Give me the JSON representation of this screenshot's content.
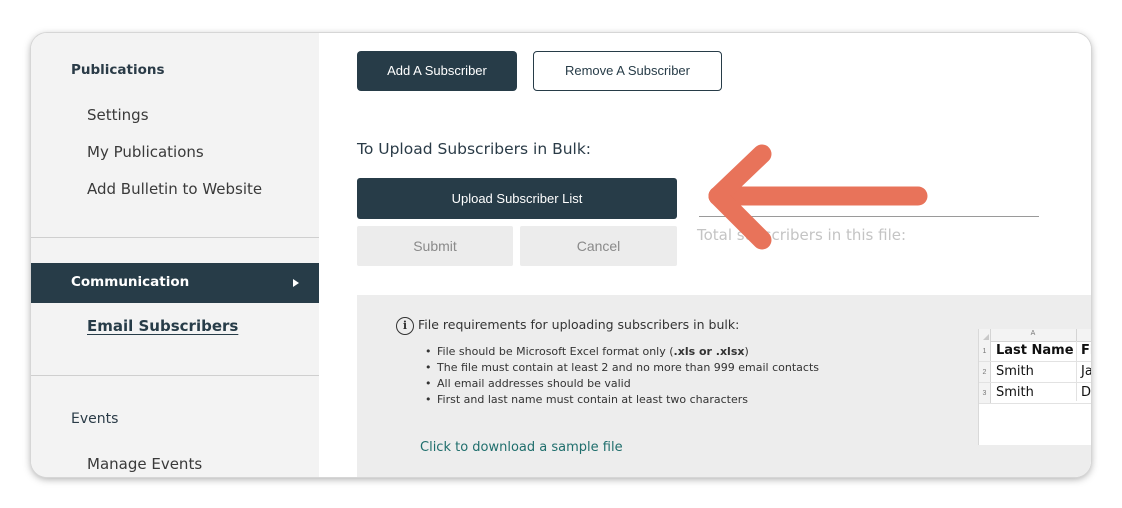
{
  "sidebar": {
    "publications_heading": "Publications",
    "publications_items": [
      "Settings",
      "My Publications",
      "Add Bulletin to Website"
    ],
    "communication_label": "Communication",
    "communication_selected_item": "Email Subscribers",
    "events_heading": "Events",
    "events_items": [
      "Manage Events"
    ]
  },
  "toolbar": {
    "add_subscriber_label": "Add A Subscriber",
    "remove_subscriber_label": "Remove A Subscriber"
  },
  "bulk_upload": {
    "heading": "To Upload Subscribers in Bulk:",
    "upload_button_label": "Upload Subscriber List",
    "submit_label": "Submit",
    "cancel_label": "Cancel",
    "total_label": "Total subscribers in this file:"
  },
  "requirements": {
    "title": "File requirements for uploading subscribers in bulk:",
    "items": [
      {
        "prefix": "File should be Microsoft Excel format only (",
        "bold": ".xls or .xlsx",
        "suffix": ")"
      },
      {
        "prefix": "The file must contain at least 2 and no more than 999 email contacts",
        "bold": "",
        "suffix": ""
      },
      {
        "prefix": "All email addresses should be valid",
        "bold": "",
        "suffix": ""
      },
      {
        "prefix": "First and last name must contain at least two characters",
        "bold": "",
        "suffix": ""
      }
    ],
    "download_link": "Click to download a sample file"
  },
  "sample_sheet": {
    "column_letter": "A",
    "row_numbers": [
      "1",
      "2",
      "3"
    ],
    "col1": [
      "Last Name",
      "Smith",
      "Smith"
    ],
    "col2": [
      "Fi",
      "Ja",
      "D"
    ]
  },
  "colors": {
    "brand_dark": "#273c48",
    "sidebar_bg": "#f3f3f3",
    "panel_bg": "#ededed",
    "link_teal": "#1f6e6c",
    "annotation_arrow": "#e8735a"
  },
  "icons": {
    "info": "info-circle-icon",
    "expand": "triangle-right-icon",
    "annotation": "arrow-left-icon"
  }
}
